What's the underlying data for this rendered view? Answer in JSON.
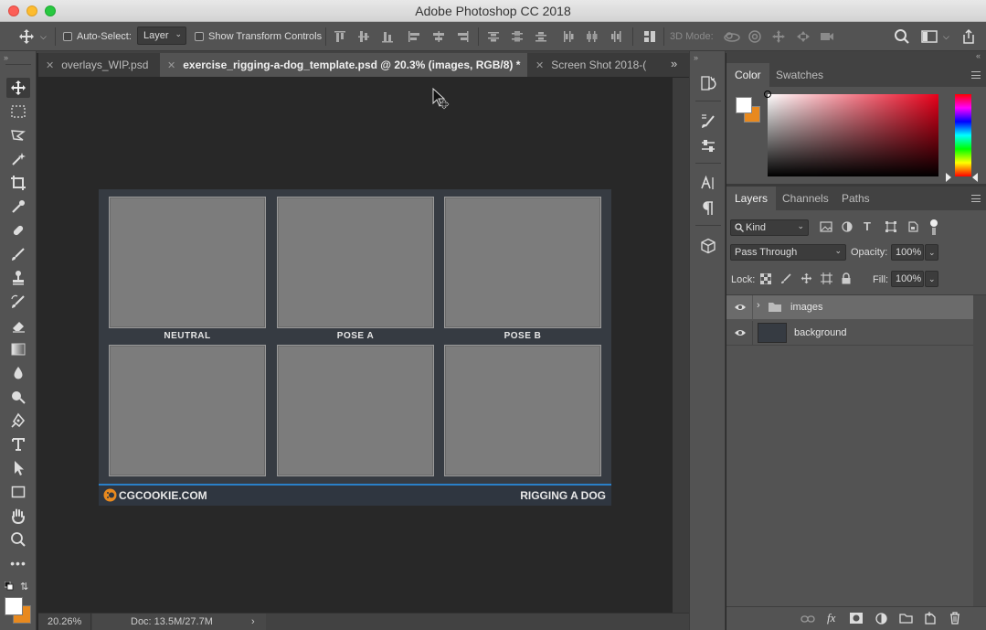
{
  "window": {
    "title": "Adobe Photoshop CC 2018"
  },
  "options_bar": {
    "auto_select_label": "Auto-Select:",
    "auto_select_value": "Layer",
    "show_transform_label": "Show Transform Controls",
    "mode_3d_label": "3D Mode:"
  },
  "tabs": [
    {
      "label": "overlays_WIP.psd",
      "active": false
    },
    {
      "label": "exercise_rigging-a-dog_template.psd @ 20.3% (images, RGB/8) *",
      "active": true
    },
    {
      "label": "Screen Shot 2018-(",
      "active": false
    }
  ],
  "document": {
    "labels": [
      "NEUTRAL",
      "POSE A",
      "POSE B"
    ],
    "footer_left": "CGCOOKIE.COM",
    "footer_right": "RIGGING A DOG"
  },
  "status": {
    "zoom": "20.26%",
    "doc_size": "Doc: 13.5M/27.7M"
  },
  "color_panel": {
    "tabs": [
      "Color",
      "Swatches"
    ],
    "foreground": "#ffffff",
    "background": "#e8891e"
  },
  "layers_panel": {
    "tabs": [
      "Layers",
      "Channels",
      "Paths"
    ],
    "filter_kind": "Kind",
    "blend_mode": "Pass Through",
    "opacity_label": "Opacity:",
    "opacity_value": "100%",
    "lock_label": "Lock:",
    "fill_label": "Fill:",
    "fill_value": "100%",
    "layers": [
      {
        "name": "images",
        "type": "group",
        "visible": true,
        "selected": true
      },
      {
        "name": "background",
        "type": "layer",
        "visible": true,
        "selected": false
      }
    ]
  },
  "colors": {
    "accent_blue": "#2a80c8",
    "panel_bg": "#535353",
    "canvas_bg": "#282828"
  }
}
